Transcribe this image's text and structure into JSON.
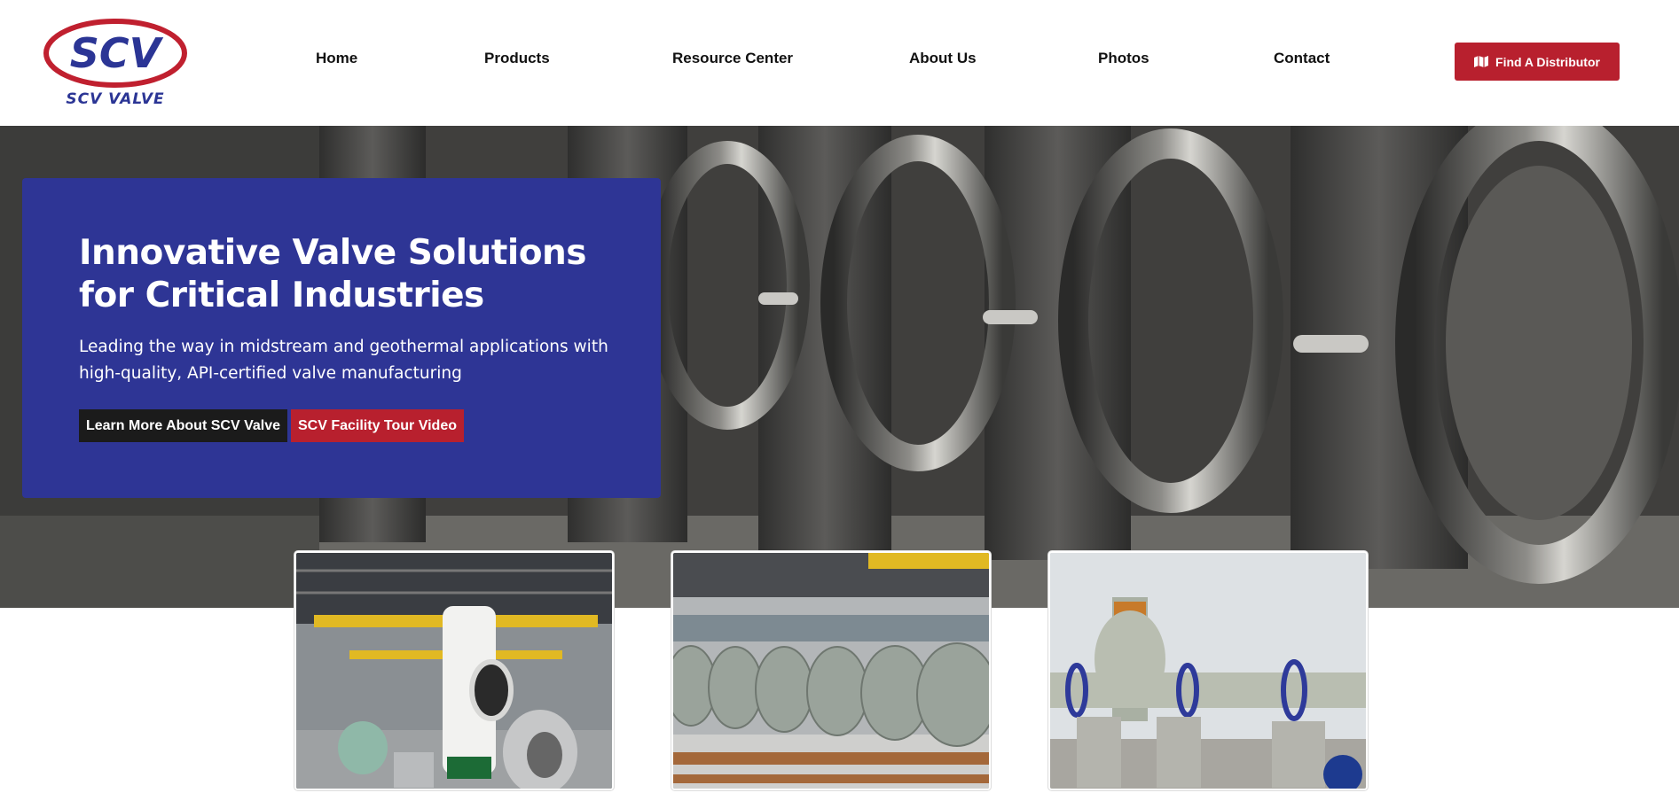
{
  "brand": {
    "logo_mark": "SCV",
    "logo_word": "SCV VALVE"
  },
  "nav": {
    "items": [
      {
        "label": "Home"
      },
      {
        "label": "Products"
      },
      {
        "label": "Resource Center"
      },
      {
        "label": "About Us"
      },
      {
        "label": "Photos"
      },
      {
        "label": "Contact"
      }
    ],
    "cta_label": "Find A Distributor",
    "cta_icon": "map-icon"
  },
  "hero": {
    "title": "Innovative Valve Solutions for Critical Industries",
    "subtitle": "Leading the way in midstream and geothermal applications with high-quality, API-certified valve manufacturing",
    "primary_button": "Learn More About SCV Valve",
    "secondary_button": "SCV Facility Tour Video"
  },
  "colors": {
    "brand_blue": "#2e3595",
    "brand_red": "#b8202e",
    "dark_button": "#1b1b1b"
  }
}
